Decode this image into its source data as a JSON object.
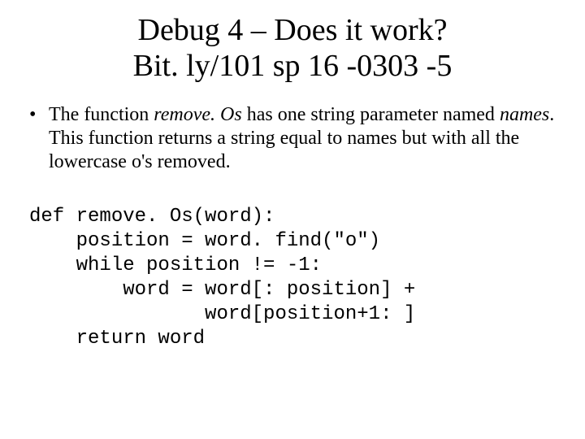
{
  "title_line1": "Debug 4 – Does it work?",
  "title_line2": "Bit. ly/101 sp 16 -0303 -5",
  "bullet": {
    "t1": "The function ",
    "em1": "remove. Os",
    "t2": " has one string parameter named ",
    "em2": "names",
    "t3": ". This function returns a string equal to names but with all the lowercase o's removed."
  },
  "code": {
    "l1": "def remove. Os(word):",
    "l2": "    position = word. find(\"o\")",
    "l3": "    while position != -1:",
    "l4": "        word = word[: position] +",
    "l5": "               word[position+1: ]",
    "l6": "    return word"
  }
}
